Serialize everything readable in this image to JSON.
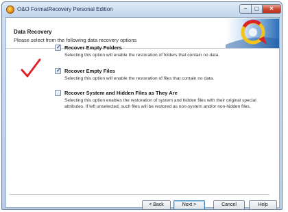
{
  "window": {
    "title": "O&O FormatRecovery Personal Edition",
    "close_glyph": "✕",
    "minimize_glyph": "–",
    "maximize_glyph": "▢"
  },
  "header": {
    "title": "Data Recovery",
    "subtitle": "Please select from the following data recovery options"
  },
  "options": [
    {
      "checked": true,
      "label": "Recover Empty Folders",
      "description": "Selecting this option will enable the restoration of folders that contain no data."
    },
    {
      "checked": true,
      "label": "Recover Empty Files",
      "description": "Selecting this option will enable the restoration of files that contain no data."
    },
    {
      "checked": false,
      "label": "Recover System and Hidden Files as They Are",
      "description": "Selecting this option enables the restoration of system and hidden files with their original special attributes. If left unselected, such files will be restored as non-system and/or non-hidden files."
    }
  ],
  "buttons": {
    "back": "< Back",
    "next": "Next >",
    "cancel": "Cancel",
    "help": "Help"
  },
  "colors": {
    "accent_red": "#d9252a",
    "banner_blue": "#2a6fb7"
  }
}
